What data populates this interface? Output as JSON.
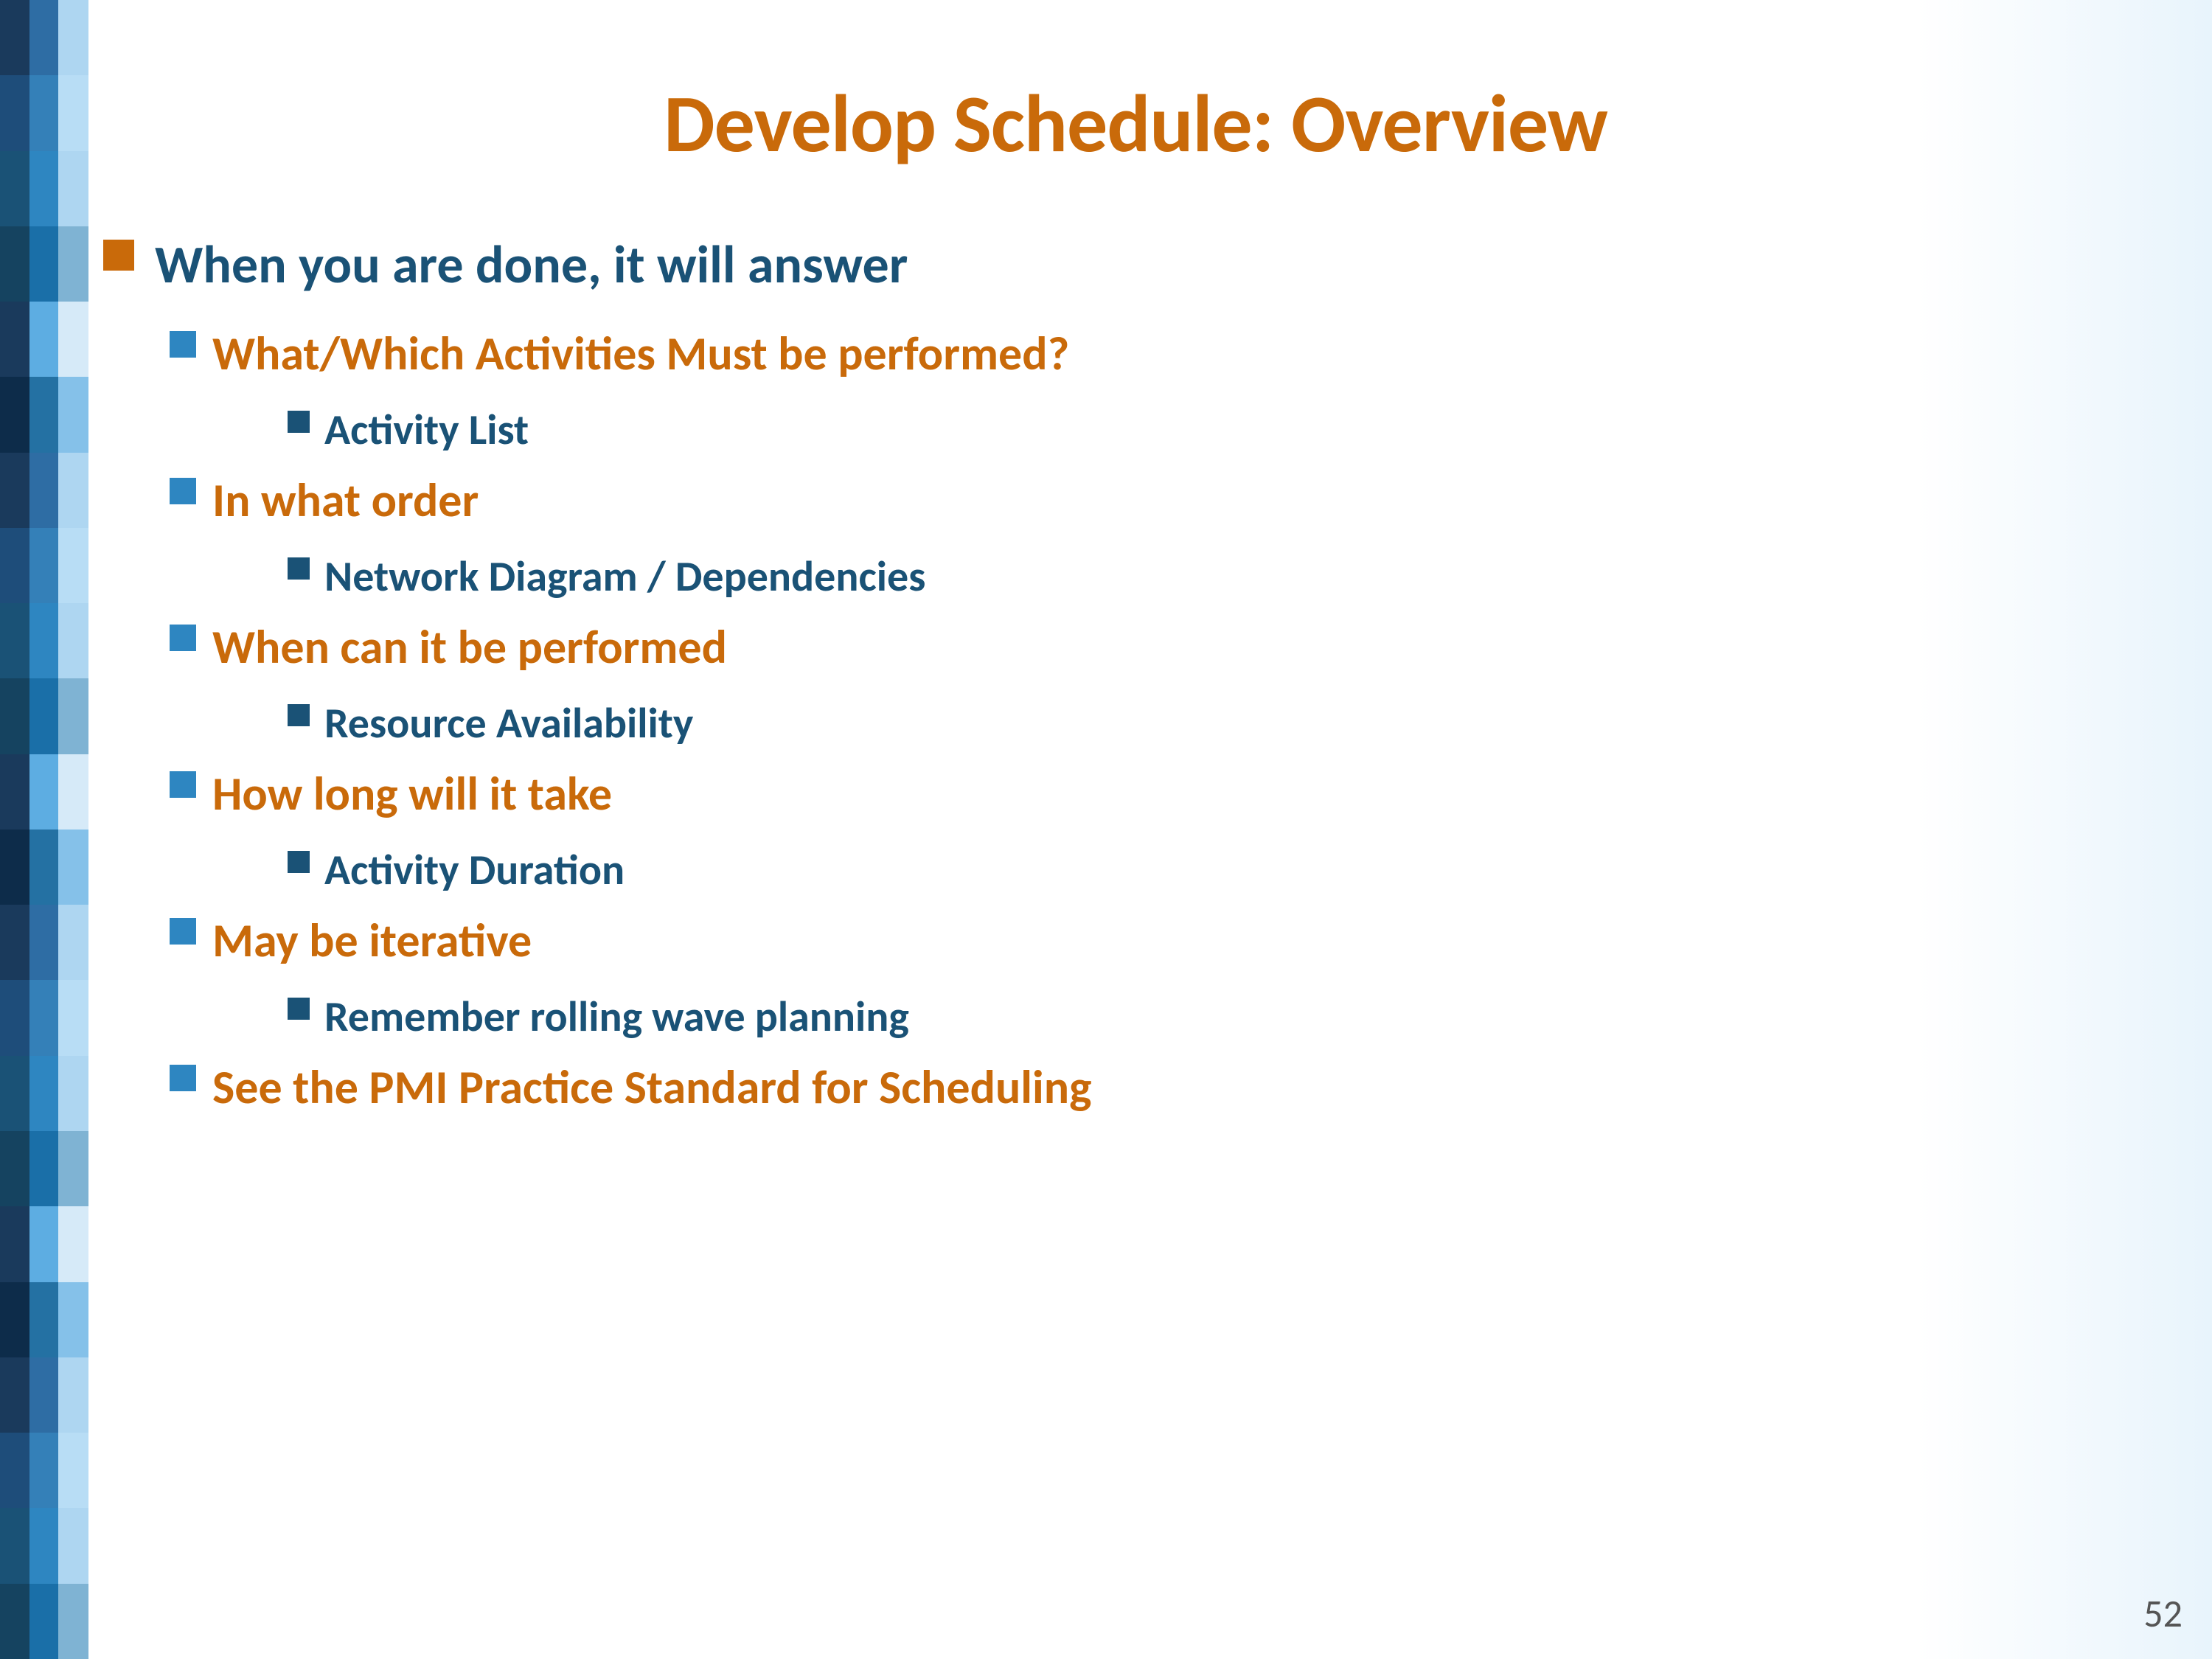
{
  "slide": {
    "title": "Develop Schedule: Overview",
    "page_number": "52",
    "colors": {
      "orange": "#c96a0a",
      "dark_blue": "#1a5276",
      "medium_blue": "#2e86c1",
      "light_blue": "#5dade2",
      "lighter_blue": "#aed6f1",
      "strip_dark": "#1a5276",
      "strip_med": "#2e86c1",
      "strip_light": "#aed6f1"
    },
    "bullet1": {
      "label": "When you are done, it will answer",
      "children": [
        {
          "label": "What/Which Activities Must be performed?",
          "children": [
            {
              "label": "Activity List"
            }
          ]
        },
        {
          "label": "In what order",
          "children": [
            {
              "label": "Network Diagram / Dependencies"
            }
          ]
        },
        {
          "label": "When can it be performed",
          "children": [
            {
              "label": "Resource Availability"
            }
          ]
        },
        {
          "label": "How long will it take",
          "children": [
            {
              "label": "Activity Duration"
            }
          ]
        },
        {
          "label": "May be iterative",
          "children": [
            {
              "label": "Remember rolling wave planning"
            }
          ]
        },
        {
          "label": "See the PMI Practice Standard for Scheduling",
          "children": []
        }
      ]
    }
  },
  "strip_rows": 22
}
